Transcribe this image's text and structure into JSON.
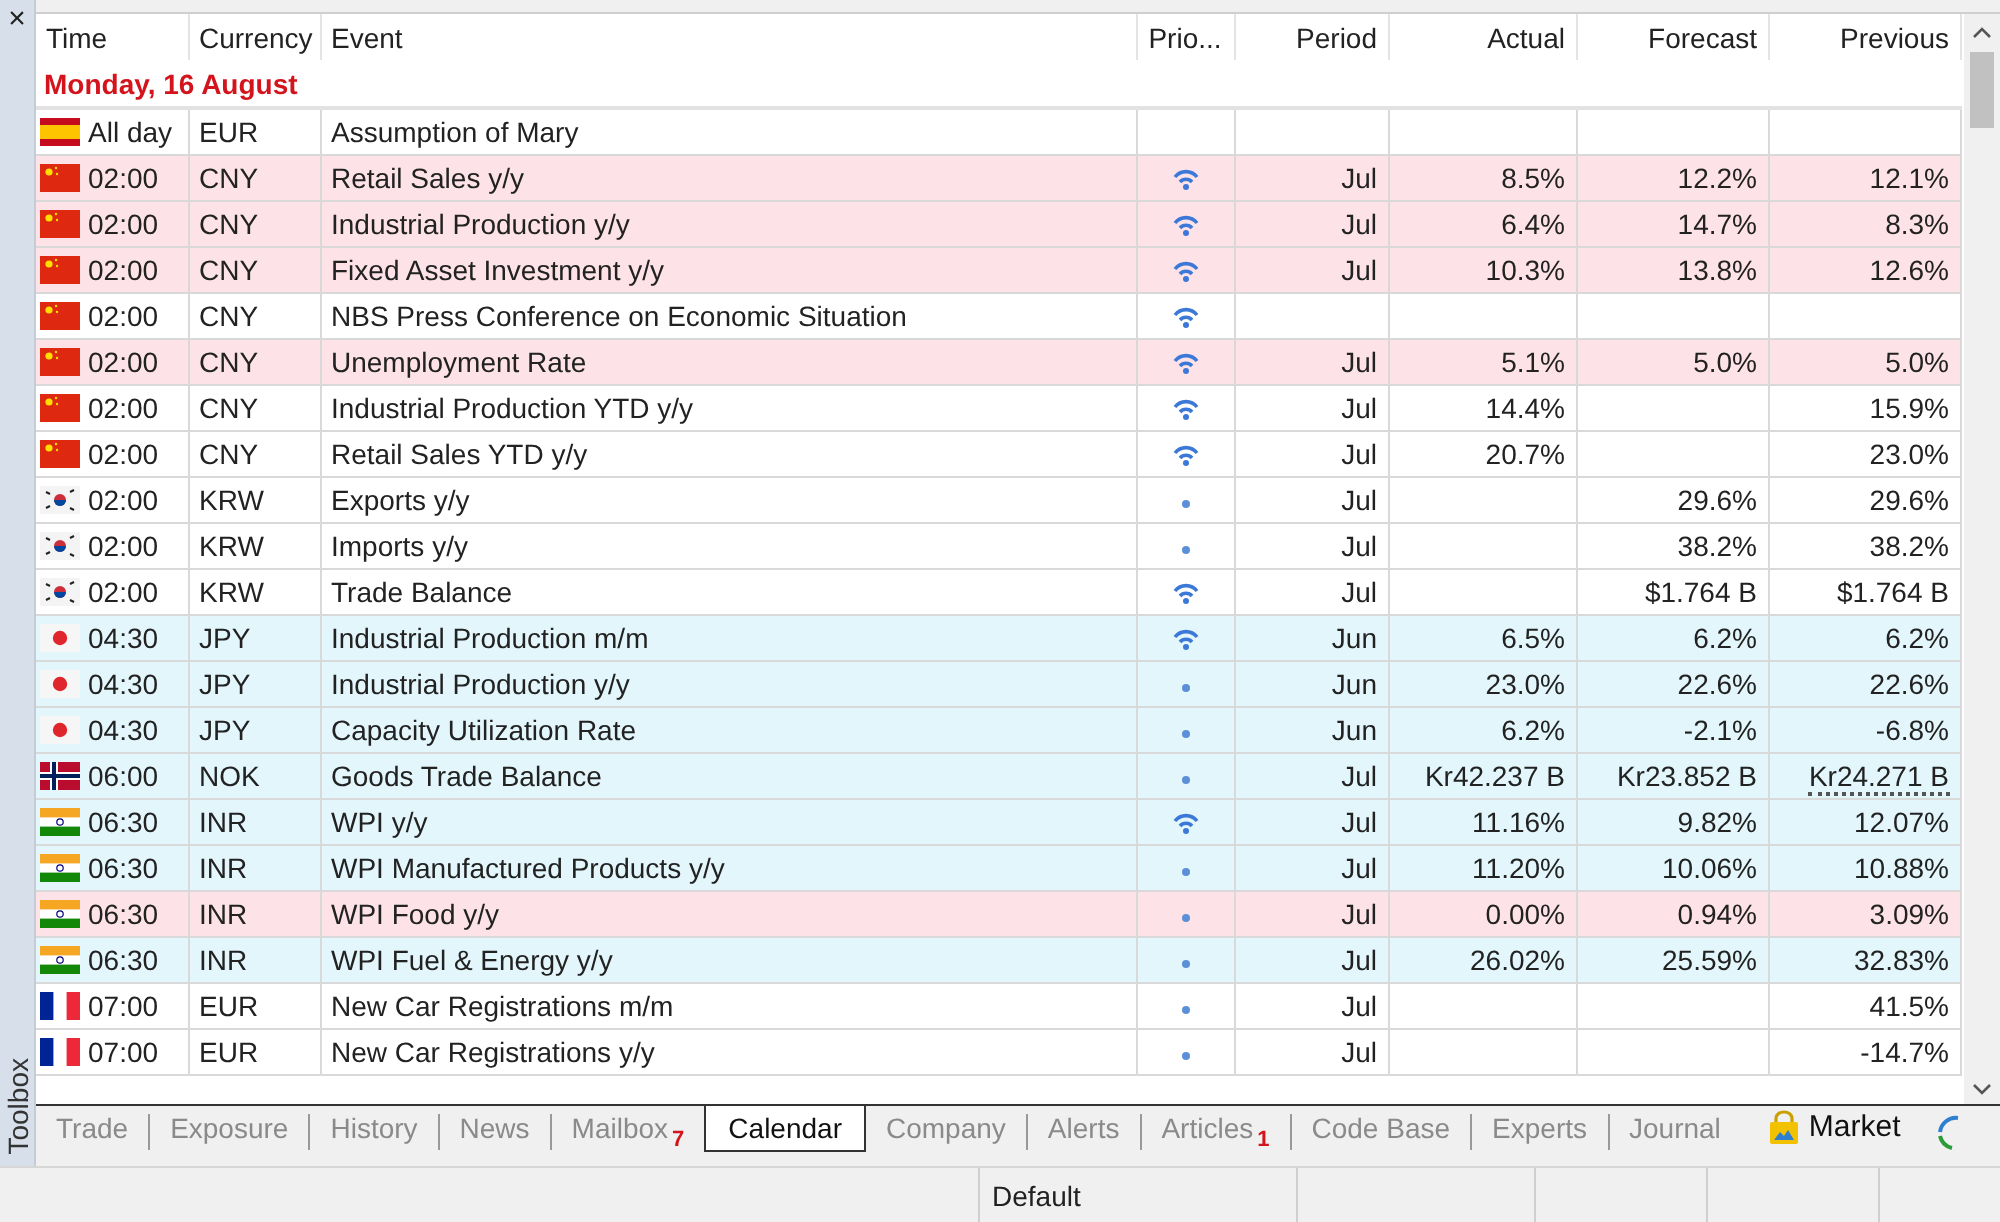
{
  "toolbox": {
    "close": "×",
    "title": "Toolbox"
  },
  "table": {
    "columns": [
      "Time",
      "Currency",
      "Event",
      "Prio...",
      "Period",
      "Actual",
      "Forecast",
      "Previous"
    ],
    "date": "Monday, 16 August",
    "rows": [
      {
        "kind": "es",
        "time": "All day",
        "currency": "EUR",
        "event": "Assumption of Mary",
        "color": "#ffffff"
      },
      {
        "kind": "cn",
        "time": "02:00",
        "currency": "CNY",
        "event": "Retail Sales y/y",
        "color": "#fde3e8",
        "priority": {
          "kind": "high"
        },
        "period": "Jul",
        "actual": "8.5%",
        "forecast": "12.2%",
        "previous": "12.1%",
        "previous_revised": false
      },
      {
        "kind": "cn",
        "time": "02:00",
        "currency": "CNY",
        "event": "Industrial Production y/y",
        "color": "#fde3e8",
        "priority": {
          "kind": "high"
        },
        "period": "Jul",
        "actual": "6.4%",
        "forecast": "14.7%",
        "previous": "8.3%",
        "previous_revised": false
      },
      {
        "kind": "cn",
        "time": "02:00",
        "currency": "CNY",
        "event": "Fixed Asset Investment y/y",
        "color": "#fde3e8",
        "priority": {
          "kind": "high"
        },
        "period": "Jul",
        "actual": "10.3%",
        "forecast": "13.8%",
        "previous": "12.6%",
        "previous_revised": false
      },
      {
        "kind": "cn",
        "time": "02:00",
        "currency": "CNY",
        "event": "NBS Press Conference on Economic Situation",
        "color": "#ffffff",
        "priority": {
          "kind": "high"
        }
      },
      {
        "kind": "cn",
        "time": "02:00",
        "currency": "CNY",
        "event": "Unemployment Rate",
        "color": "#fde3e8",
        "priority": {
          "kind": "high"
        },
        "period": "Jul",
        "actual": "5.1%",
        "forecast": "5.0%",
        "previous": "5.0%",
        "previous_revised": false
      },
      {
        "kind": "cn",
        "time": "02:00",
        "currency": "CNY",
        "event": "Industrial Production YTD y/y",
        "color": "#ffffff",
        "priority": {
          "kind": "high"
        },
        "period": "Jul",
        "actual": "14.4%",
        "forecast": "",
        "previous": "15.9%",
        "previous_revised": false
      },
      {
        "kind": "cn",
        "time": "02:00",
        "currency": "CNY",
        "event": "Retail Sales YTD y/y",
        "color": "#ffffff",
        "priority": {
          "kind": "high"
        },
        "period": "Jul",
        "actual": "20.7%",
        "forecast": "",
        "previous": "23.0%",
        "previous_revised": false
      },
      {
        "kind": "kr",
        "time": "02:00",
        "currency": "KRW",
        "event": "Exports y/y",
        "color": "#ffffff",
        "priority": {
          "kind": "low"
        },
        "period": "Jul",
        "actual": "",
        "forecast": "29.6%",
        "previous": "29.6%",
        "previous_revised": false
      },
      {
        "kind": "kr",
        "time": "02:00",
        "currency": "KRW",
        "event": "Imports y/y",
        "color": "#ffffff",
        "priority": {
          "kind": "low"
        },
        "period": "Jul",
        "actual": "",
        "forecast": "38.2%",
        "previous": "38.2%",
        "previous_revised": false
      },
      {
        "kind": "kr",
        "time": "02:00",
        "currency": "KRW",
        "event": "Trade Balance",
        "color": "#ffffff",
        "priority": {
          "kind": "high"
        },
        "period": "Jul",
        "actual": "",
        "forecast": "$1.764 B",
        "previous": "$1.764 B",
        "previous_revised": false
      },
      {
        "kind": "jp",
        "time": "04:30",
        "currency": "JPY",
        "event": "Industrial Production m/m",
        "color": "#e2f6fc",
        "priority": {
          "kind": "high"
        },
        "period": "Jun",
        "actual": "6.5%",
        "forecast": "6.2%",
        "previous": "6.2%",
        "previous_revised": false
      },
      {
        "kind": "jp",
        "time": "04:30",
        "currency": "JPY",
        "event": "Industrial Production y/y",
        "color": "#e2f6fc",
        "priority": {
          "kind": "low"
        },
        "period": "Jun",
        "actual": "23.0%",
        "forecast": "22.6%",
        "previous": "22.6%",
        "previous_revised": false
      },
      {
        "kind": "jp",
        "time": "04:30",
        "currency": "JPY",
        "event": "Capacity Utilization Rate",
        "color": "#e2f6fc",
        "priority": {
          "kind": "low"
        },
        "period": "Jun",
        "actual": "6.2%",
        "forecast": "-2.1%",
        "previous": "-6.8%",
        "previous_revised": false
      },
      {
        "kind": "no",
        "time": "06:00",
        "currency": "NOK",
        "event": "Goods Trade Balance",
        "color": "#e2f6fc",
        "priority": {
          "kind": "low"
        },
        "period": "Jul",
        "actual": "Kr42.237 B",
        "forecast": "Kr23.852 B",
        "previous": "Kr24.271 B",
        "previous_revised": true
      },
      {
        "kind": "in",
        "time": "06:30",
        "currency": "INR",
        "event": "WPI y/y",
        "color": "#e2f6fc",
        "priority": {
          "kind": "high"
        },
        "period": "Jul",
        "actual": "11.16%",
        "forecast": "9.82%",
        "previous": "12.07%",
        "previous_revised": false
      },
      {
        "kind": "in",
        "time": "06:30",
        "currency": "INR",
        "event": "WPI Manufactured Products y/y",
        "color": "#e2f6fc",
        "priority": {
          "kind": "low"
        },
        "period": "Jul",
        "actual": "11.20%",
        "forecast": "10.06%",
        "previous": "10.88%",
        "previous_revised": false
      },
      {
        "kind": "in",
        "time": "06:30",
        "currency": "INR",
        "event": "WPI Food y/y",
        "color": "#fde3e8",
        "priority": {
          "kind": "low"
        },
        "period": "Jul",
        "actual": "0.00%",
        "forecast": "0.94%",
        "previous": "3.09%",
        "previous_revised": false
      },
      {
        "kind": "in",
        "time": "06:30",
        "currency": "INR",
        "event": "WPI Fuel & Energy y/y",
        "color": "#e2f6fc",
        "priority": {
          "kind": "low"
        },
        "period": "Jul",
        "actual": "26.02%",
        "forecast": "25.59%",
        "previous": "32.83%",
        "previous_revised": false
      },
      {
        "kind": "fr",
        "time": "07:00",
        "currency": "EUR",
        "event": "New Car Registrations m/m",
        "color": "#ffffff",
        "priority": {
          "kind": "low"
        },
        "period": "Jul",
        "actual": "",
        "forecast": "",
        "previous": "41.5%",
        "previous_revised": false
      },
      {
        "kind": "fr",
        "time": "07:00",
        "currency": "EUR",
        "event": "New Car Registrations y/y",
        "color": "#ffffff",
        "priority": {
          "kind": "low"
        },
        "period": "Jul",
        "actual": "",
        "forecast": "",
        "previous": "-14.7%",
        "previous_revised": false
      }
    ]
  },
  "tabs": [
    {
      "label": "Trade",
      "selected": false
    },
    {
      "label": "Exposure",
      "selected": false
    },
    {
      "label": "History",
      "selected": false
    },
    {
      "label": "News",
      "selected": false
    },
    {
      "label": "Mailbox",
      "badge": "7",
      "selected": false
    },
    {
      "label": "Calendar",
      "selected": true
    },
    {
      "label": "Company",
      "selected": false
    },
    {
      "label": "Alerts",
      "selected": false
    },
    {
      "label": "Articles",
      "badge": "1",
      "selected": false
    },
    {
      "label": "Code Base",
      "selected": false
    },
    {
      "label": "Experts",
      "selected": false
    },
    {
      "label": "Journal",
      "selected": false
    },
    {
      "label": "Market",
      "kind": "market",
      "selected": false
    }
  ],
  "status_bar": {
    "profile": "Default"
  }
}
